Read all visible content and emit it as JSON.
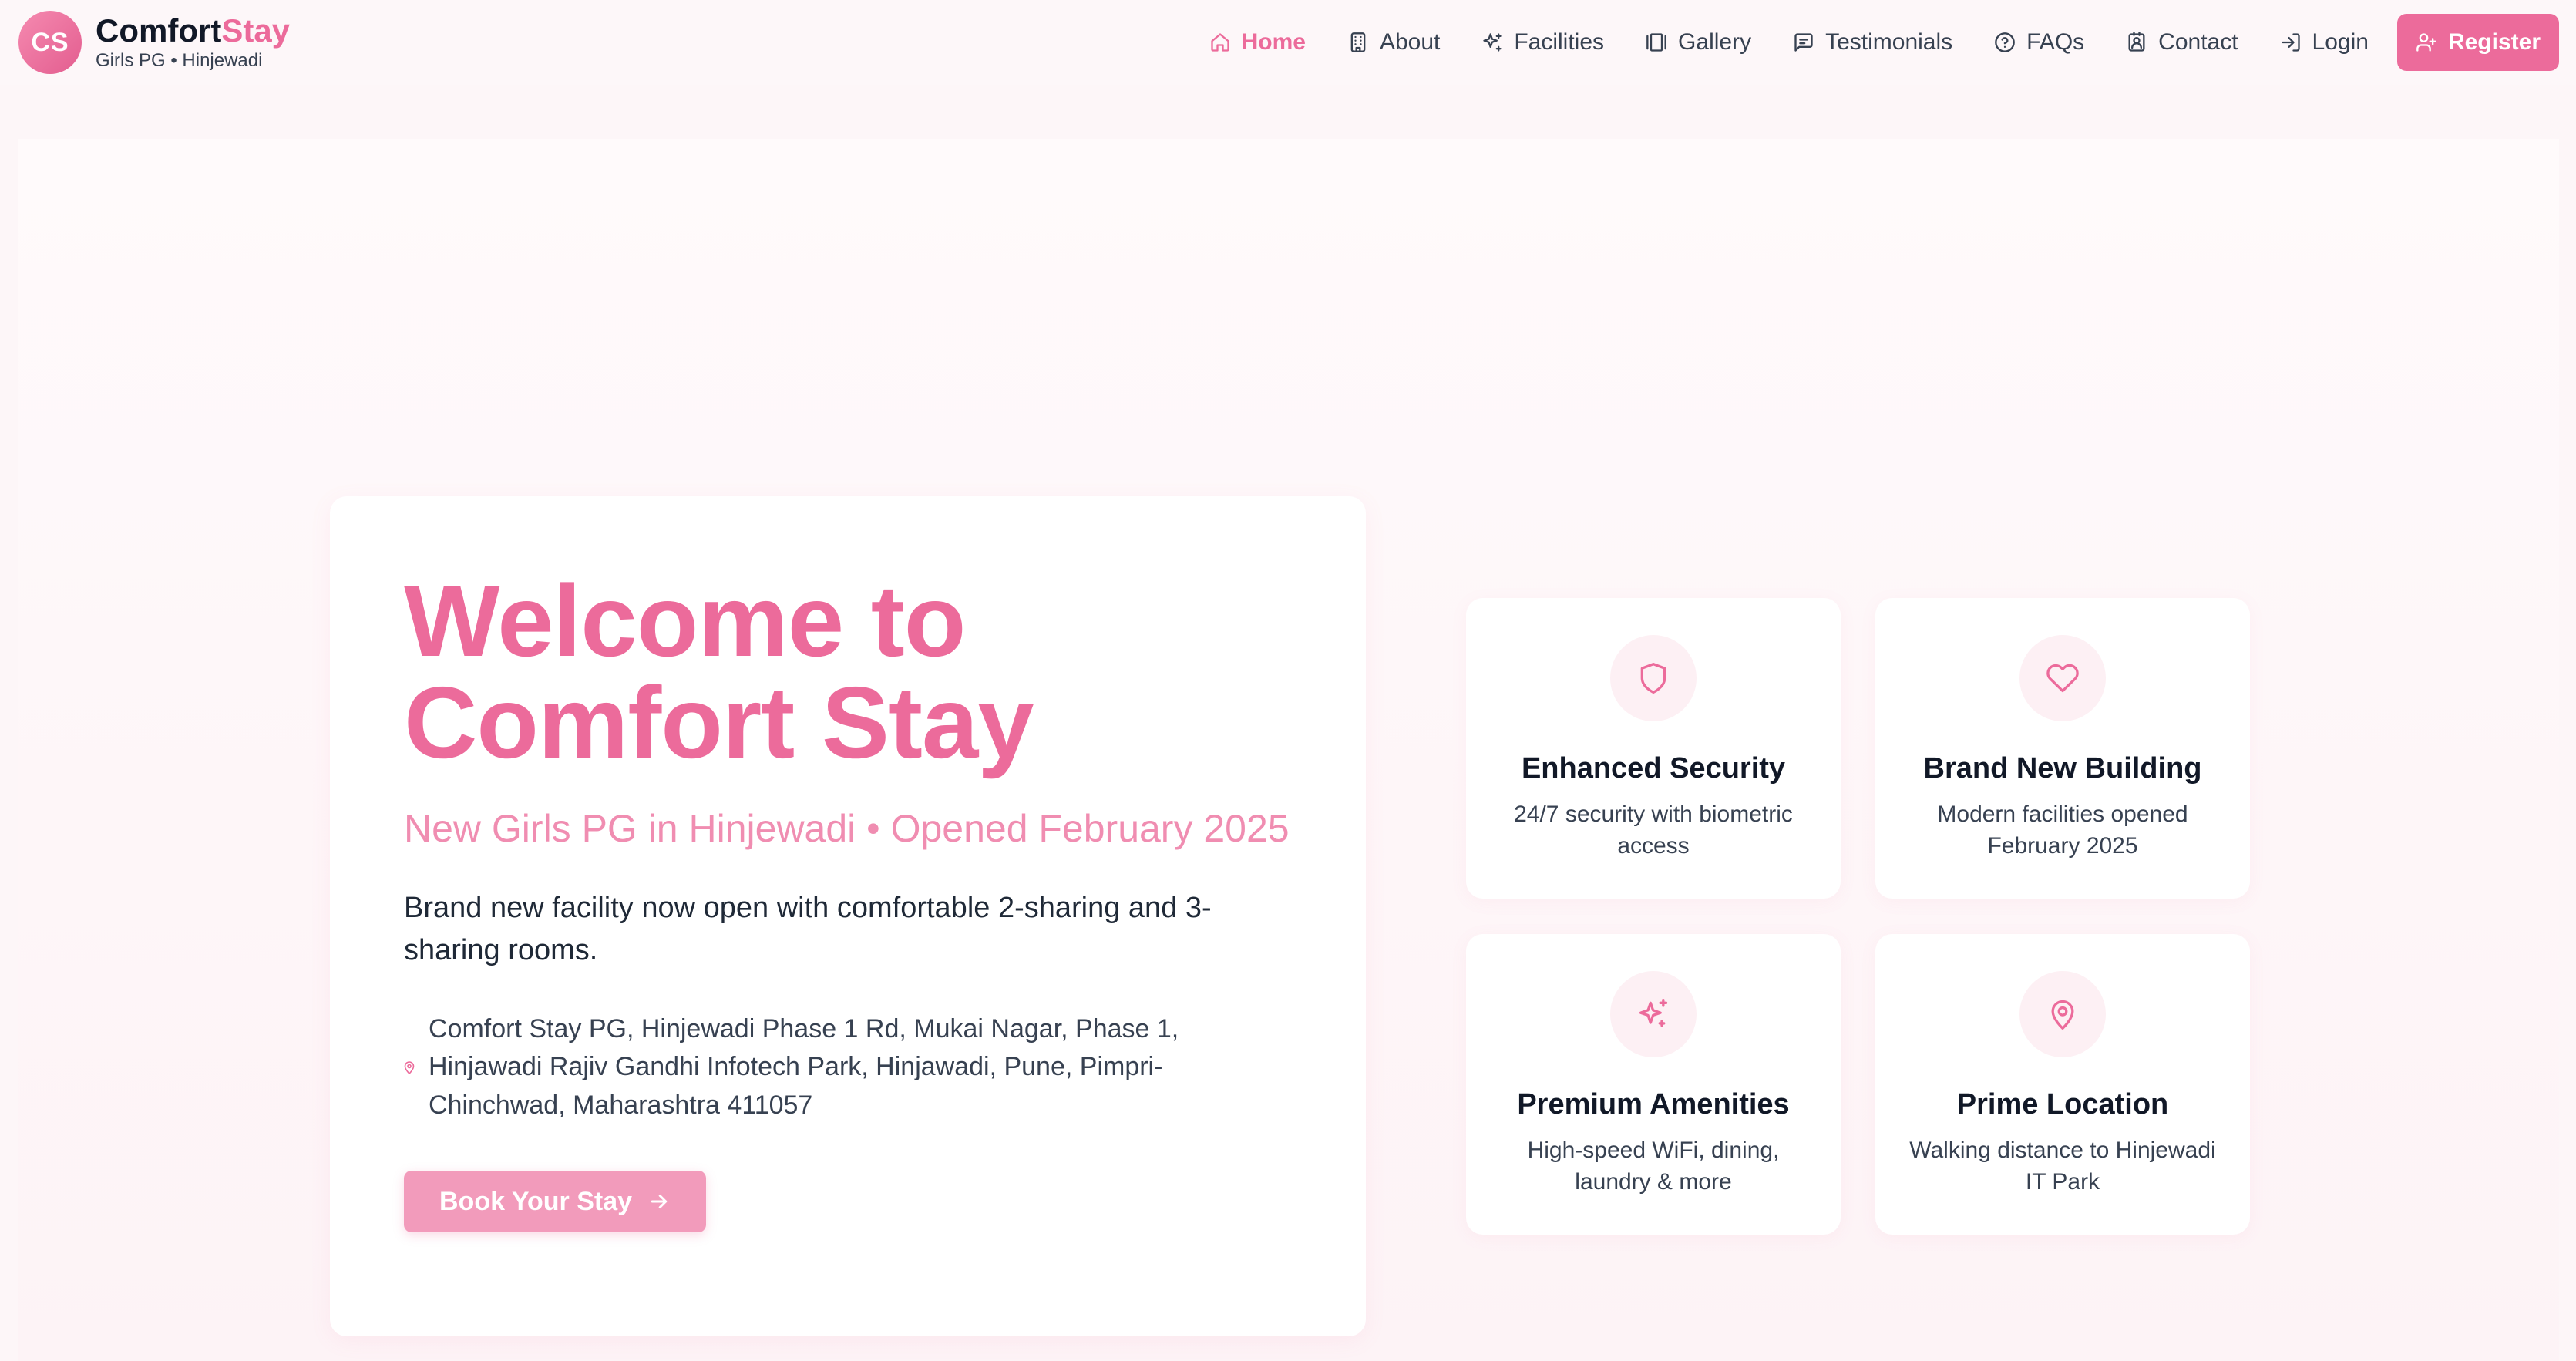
{
  "brand": {
    "logo_initials": "CS",
    "name_part1": "Comfort",
    "name_part2": "Stay",
    "subtitle": "Girls PG • Hinjewadi"
  },
  "nav": {
    "items": [
      {
        "label": "Home",
        "icon": "home-icon",
        "active": true
      },
      {
        "label": "About",
        "icon": "building-icon",
        "active": false
      },
      {
        "label": "Facilities",
        "icon": "sparkles-icon",
        "active": false
      },
      {
        "label": "Gallery",
        "icon": "gallery-icon",
        "active": false
      },
      {
        "label": "Testimonials",
        "icon": "message-icon",
        "active": false
      },
      {
        "label": "FAQs",
        "icon": "help-circle-icon",
        "active": false
      },
      {
        "label": "Contact",
        "icon": "contact-icon",
        "active": false
      },
      {
        "label": "Login",
        "icon": "login-icon",
        "active": false
      }
    ],
    "register_label": "Register"
  },
  "hero": {
    "title_line1": "Welcome to",
    "title_line2": "Comfort Stay",
    "subtitle": "New Girls PG in Hinjewadi • Opened February 2025",
    "description": "Brand new facility now open with comfortable 2-sharing and 3-sharing rooms.",
    "address": "Comfort Stay PG, Hinjewadi Phase 1 Rd, Mukai Nagar, Phase 1, Hinjawadi Rajiv Gandhi Infotech Park, Hinjawadi, Pune, Pimpri-Chinchwad, Maharashtra 411057",
    "cta_label": "Book Your Stay"
  },
  "features": [
    {
      "title": "Enhanced Security",
      "description": "24/7 security with biometric access",
      "icon": "shield-icon"
    },
    {
      "title": "Brand New Building",
      "description": "Modern facilities opened February 2025",
      "icon": "heart-icon"
    },
    {
      "title": "Premium Amenities",
      "description": "High-speed WiFi, dining, laundry & more",
      "icon": "sparkles-icon"
    },
    {
      "title": "Prime Location",
      "description": "Walking distance to Hinjewadi IT Park",
      "icon": "map-pin-icon"
    }
  ],
  "colors": {
    "accent": "#ec6b9b",
    "accent_light": "#f29bbb",
    "background": "#fdf6f8"
  }
}
